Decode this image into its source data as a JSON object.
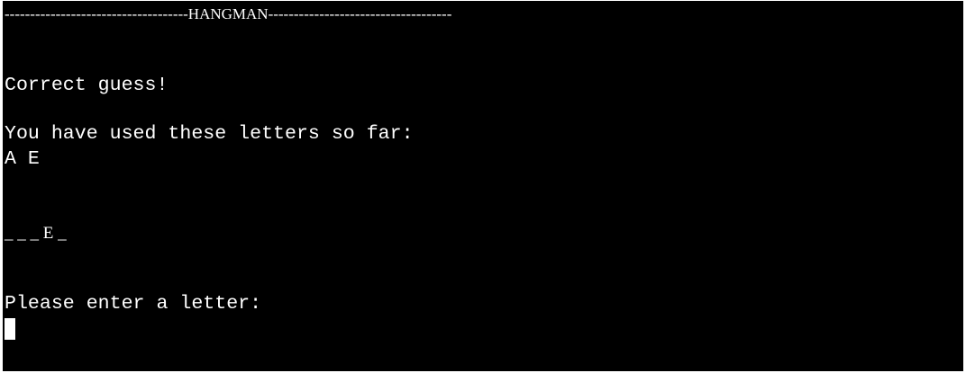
{
  "terminal": {
    "title_banner": "------------------------------------HANGMAN------------------------------------",
    "status_message": "Correct guess!",
    "used_letters_label": "You have used these letters so far:",
    "used_letters": "A E",
    "word_progress": "_ _ _ E _",
    "prompt": "Please enter a letter:",
    "colors": {
      "background": "#000000",
      "text": "#ffffff"
    }
  }
}
